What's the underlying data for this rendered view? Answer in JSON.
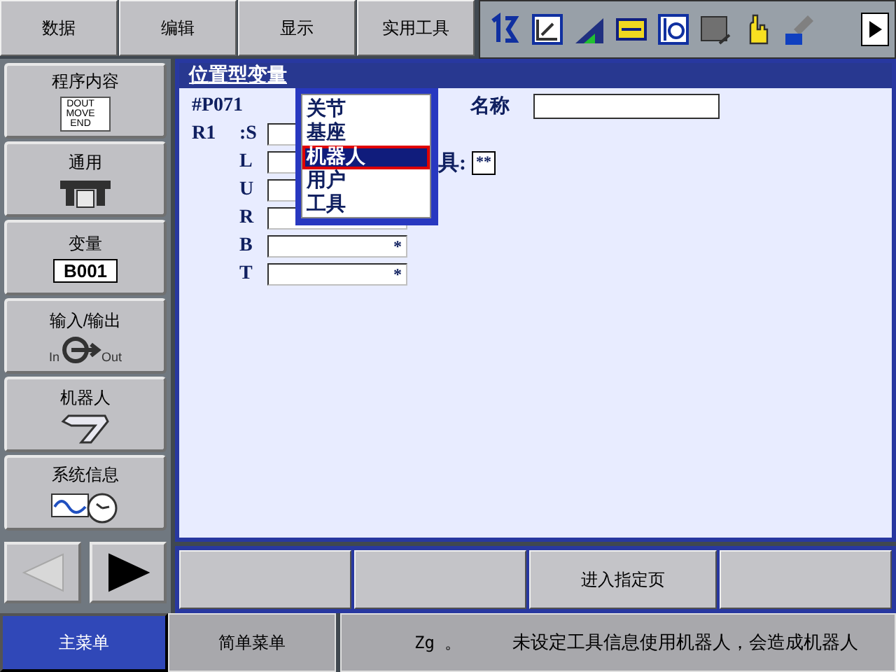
{
  "menu_bar": [
    {
      "label": "数据"
    },
    {
      "label": "编辑"
    },
    {
      "label": "显示"
    },
    {
      "label": "实用工具"
    }
  ],
  "side_menu": [
    {
      "label": "程序内容",
      "kind": "program",
      "icon_lines": [
        "DOUT",
        "MOVE",
        "END"
      ]
    },
    {
      "label": "通用",
      "kind": "gripper"
    },
    {
      "label": "变量",
      "kind": "variable",
      "icon_lines": [
        "B001"
      ]
    },
    {
      "label": "输入/输出",
      "kind": "io",
      "icon_lines": [
        "In",
        "Out"
      ]
    },
    {
      "label": "机器人",
      "kind": "robot"
    },
    {
      "label": "系统信息",
      "kind": "sysinfo"
    }
  ],
  "page_nav": {
    "prev_disabled": true,
    "next_disabled": false
  },
  "panel": {
    "title": "位置型变量",
    "number": "#P071",
    "name_label": "名称",
    "group_label": "R1",
    "axes": [
      {
        "label": ":S"
      },
      {
        "label": "L"
      },
      {
        "label": "U"
      },
      {
        "label": "R"
      },
      {
        "label": "B",
        "value": "*"
      },
      {
        "label": "T",
        "value": "*"
      }
    ],
    "tool_label": "具:",
    "tool_value": "**",
    "frame_dropdown": [
      {
        "label": "关节",
        "selected": false
      },
      {
        "label": "基座",
        "selected": false
      },
      {
        "label": "机器人",
        "selected": true
      },
      {
        "label": "用户",
        "selected": false
      },
      {
        "label": "工具",
        "selected": false
      }
    ]
  },
  "function_keys": [
    {
      "kind": "blank"
    },
    {
      "kind": "blank"
    },
    {
      "kind": "key",
      "label": "进入指定页"
    },
    {
      "kind": "blank"
    }
  ],
  "bottom_bar": {
    "main_menu": "主菜单",
    "simple_menu": "简单菜单",
    "status": "Zg 。",
    "message": "未设定工具信息使用机器人，会造成机器人"
  }
}
